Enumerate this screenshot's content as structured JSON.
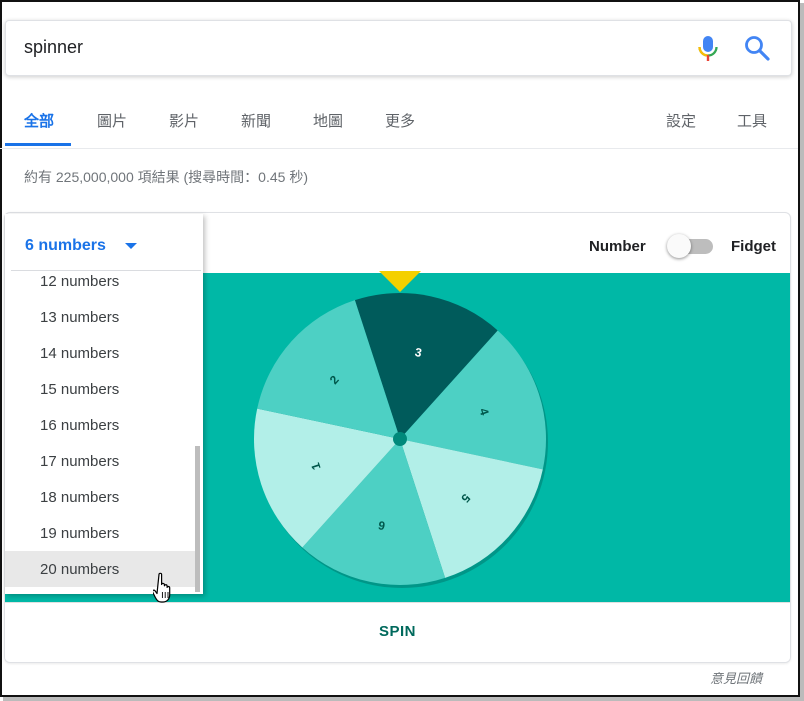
{
  "search": {
    "query": "spinner"
  },
  "tabs": {
    "left": [
      "全部",
      "圖片",
      "影片",
      "新聞",
      "地圖",
      "更多"
    ],
    "right": [
      "設定",
      "工具"
    ]
  },
  "stats": "約有 225,000,000 項結果 (搜尋時間：0.45 秒)",
  "spinner": {
    "dropdown_selected": "6 numbers",
    "dropdown_options": [
      "12 numbers",
      "13 numbers",
      "14 numbers",
      "15 numbers",
      "16 numbers",
      "17 numbers",
      "18 numbers",
      "19 numbers",
      "20 numbers"
    ],
    "hovered_option": "20 numbers",
    "mode_number": "Number",
    "mode_fidget": "Fidget",
    "mode_toggle_on": false,
    "wheel_labels": [
      "3",
      "4",
      "5",
      "6",
      "1",
      "2"
    ],
    "spin_label": "SPIN",
    "colors": {
      "background": "#00b8a6",
      "pointer": "#f4d000",
      "segments": [
        "#005b5b",
        "#4dd0c4",
        "#b2efe8",
        "#4dd0c4",
        "#b2efe8",
        "#4dd0c4"
      ]
    }
  },
  "feedback": "意見回饋"
}
